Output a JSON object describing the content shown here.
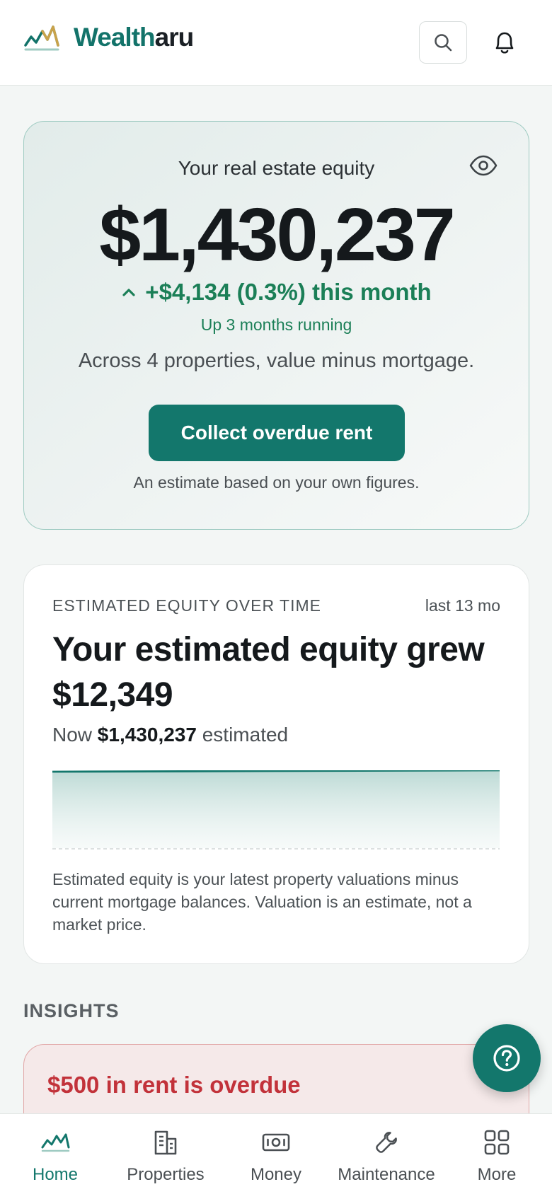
{
  "header": {
    "brand_part1": "Wealth",
    "brand_part2": "aru",
    "logo_icon": "mountain-trend-logo",
    "search_icon": "search-icon",
    "notification_icon": "bell-icon"
  },
  "hero": {
    "label": "Your real estate equity",
    "amount": "$1,430,237",
    "change": "+$4,134 (0.3%) this month",
    "streak": "Up 3 months running",
    "description": "Across 4 properties, value minus mortgage.",
    "cta_label": "Collect overdue rent",
    "note": "An estimate based on your own figures.",
    "visibility_icon": "eye-icon"
  },
  "equity_card": {
    "overline": "ESTIMATED EQUITY OVER TIME",
    "range": "last 13 mo",
    "headline": "Your estimated equity grew $12,349",
    "now_prefix": "Now",
    "now_value": "$1,430,237",
    "now_suffix": "estimated",
    "footnote": "Estimated equity is your latest property valuations minus current mortgage balances. Valuation is an estimate, not a market price."
  },
  "insights": {
    "title": "INSIGHTS",
    "alert_title": "$500 in rent is overdue"
  },
  "nav": {
    "items": [
      {
        "label": "Home",
        "icon": "trend-icon",
        "active": true
      },
      {
        "label": "Properties",
        "icon": "building-icon",
        "active": false
      },
      {
        "label": "Money",
        "icon": "banknote-icon",
        "active": false
      },
      {
        "label": "Maintenance",
        "icon": "wrench-icon",
        "active": false
      },
      {
        "label": "More",
        "icon": "grid-icon",
        "active": false
      }
    ]
  },
  "colors": {
    "brand_teal": "#13776c",
    "positive_green": "#1b7f57",
    "alert_red": "#c2323a",
    "brand_gold": "#c9a24a"
  }
}
